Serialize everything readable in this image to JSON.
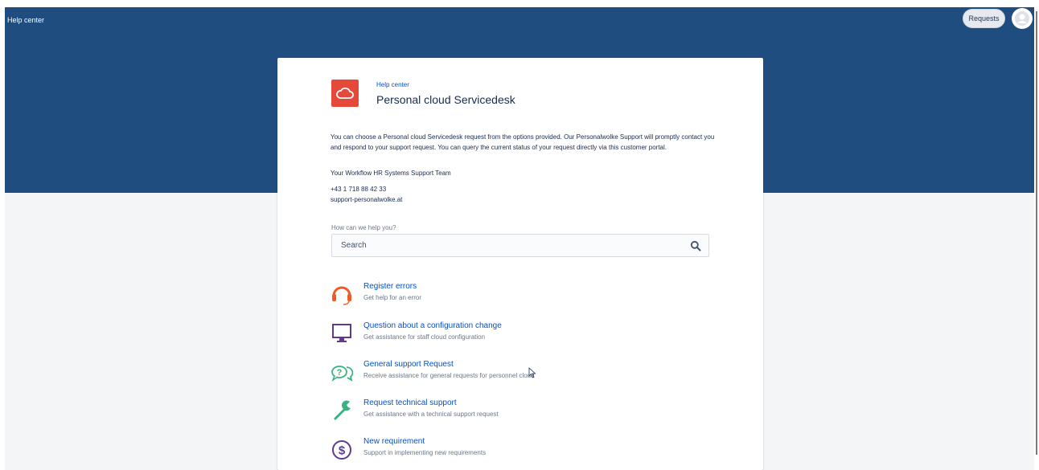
{
  "header": {
    "brand": "Help center",
    "requests_label": "Requests",
    "avatar_icon": "user-avatar-icon"
  },
  "portal": {
    "breadcrumb": "Help center",
    "title": "Personal cloud Servicedesk",
    "logo_icon": "cloud-icon",
    "intro": "You can choose a Personal cloud Servicedesk request from the options provided. Our Personalwolke Support will promptly contact you and respond to your support request. You can query the current status of your request directly via this customer portal.",
    "team": "Your Workflow HR Systems Support Team",
    "phone": "+43 1 718 88 42 33",
    "email": "support-personalwolke.at"
  },
  "search": {
    "label": "How can we help you?",
    "placeholder": "Search"
  },
  "request_types": [
    {
      "title": "Register errors",
      "description": "Get help for an error",
      "icon": "headset-icon"
    },
    {
      "title": "Question about a configuration change",
      "description": "Get assistance for staff cloud configuration",
      "icon": "monitor-icon"
    },
    {
      "title": "General support Request",
      "description": "Receive assistance for general requests for personnel cloud",
      "icon": "question-chat-icon"
    },
    {
      "title": "Request technical support",
      "description": "Get assistance with a technical support request",
      "icon": "wrench-icon"
    },
    {
      "title": "New requirement",
      "description": "Support in implementing new requirements",
      "icon": "dollar-icon"
    }
  ],
  "colors": {
    "banner": "#1f4d7f",
    "link": "#0052cc",
    "logo": "#e5493a",
    "headset": "#f15a24",
    "monitor": "#5e3b8c",
    "question": "#36b37e",
    "wrench": "#36b37e",
    "dollar": "#5e3b8c"
  }
}
